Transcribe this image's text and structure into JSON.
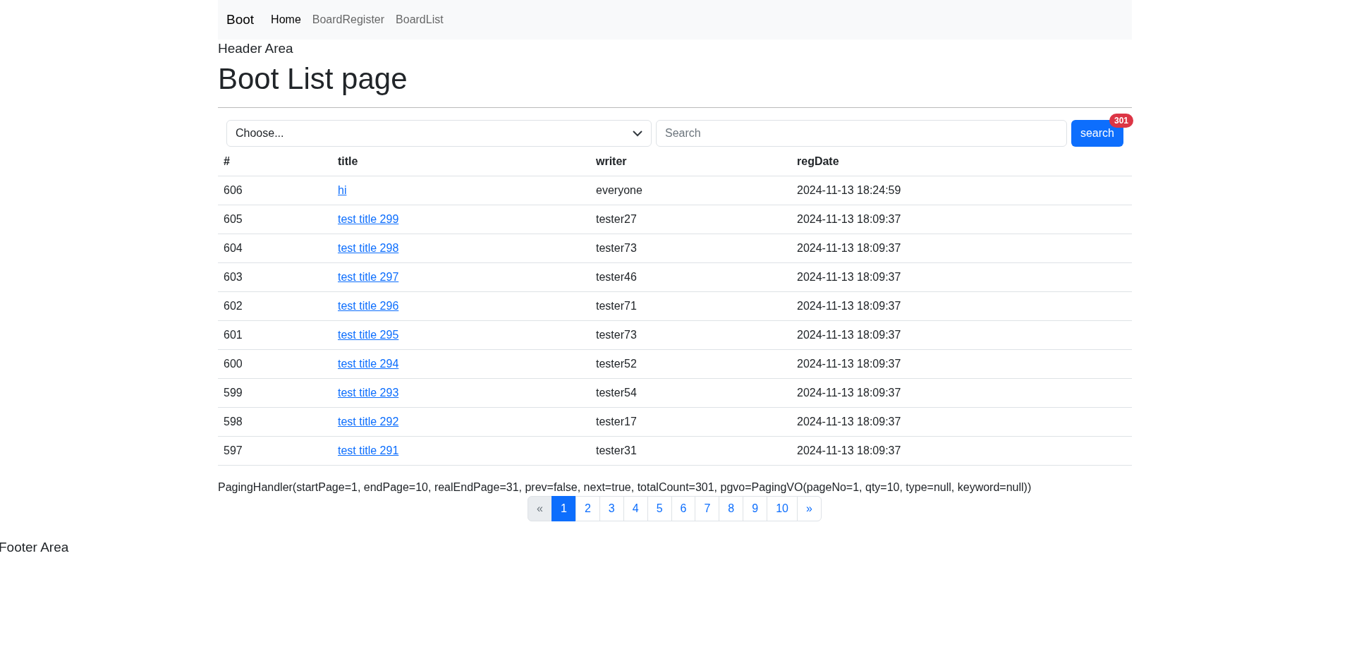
{
  "navbar": {
    "brand": "Boot",
    "items": [
      {
        "label": "Home",
        "selected": true
      },
      {
        "label": "BoardRegister",
        "selected": false
      },
      {
        "label": "BoardList",
        "selected": false
      }
    ]
  },
  "header_text": "Header Area",
  "page_title": "Boot List page",
  "search": {
    "select": "Choose...",
    "placeholder": "Search",
    "button": "search",
    "badge": "301"
  },
  "table": {
    "columns": [
      "#",
      "title",
      "writer",
      "regDate"
    ],
    "rows": [
      {
        "no": "606",
        "title": "hi",
        "writer": "everyone",
        "regDate": "2024-11-13 18:24:59"
      },
      {
        "no": "605",
        "title": "test title 299",
        "writer": "tester27",
        "regDate": "2024-11-13 18:09:37"
      },
      {
        "no": "604",
        "title": "test title 298",
        "writer": "tester73",
        "regDate": "2024-11-13 18:09:37"
      },
      {
        "no": "603",
        "title": "test title 297",
        "writer": "tester46",
        "regDate": "2024-11-13 18:09:37"
      },
      {
        "no": "602",
        "title": "test title 296",
        "writer": "tester71",
        "regDate": "2024-11-13 18:09:37"
      },
      {
        "no": "601",
        "title": "test title 295",
        "writer": "tester73",
        "regDate": "2024-11-13 18:09:37"
      },
      {
        "no": "600",
        "title": "test title 294",
        "writer": "tester52",
        "regDate": "2024-11-13 18:09:37"
      },
      {
        "no": "599",
        "title": "test title 293",
        "writer": "tester54",
        "regDate": "2024-11-13 18:09:37"
      },
      {
        "no": "598",
        "title": "test title 292",
        "writer": "tester17",
        "regDate": "2024-11-13 18:09:37"
      },
      {
        "no": "597",
        "title": "test title 291",
        "writer": "tester31",
        "regDate": "2024-11-13 18:09:37"
      }
    ]
  },
  "paging_info": "PagingHandler(startPage=1, endPage=10, realEndPage=31, prev=false, next=true, totalCount=301, pgvo=PagingVO(pageNo=1, qty=10, type=null, keyword=null))",
  "pagination": [
    {
      "label": "«",
      "disabled": true,
      "selected": false
    },
    {
      "label": "1",
      "disabled": false,
      "selected": true
    },
    {
      "label": "2",
      "disabled": false,
      "selected": false
    },
    {
      "label": "3",
      "disabled": false,
      "selected": false
    },
    {
      "label": "4",
      "disabled": false,
      "selected": false
    },
    {
      "label": "5",
      "disabled": false,
      "selected": false
    },
    {
      "label": "6",
      "disabled": false,
      "selected": false
    },
    {
      "label": "7",
      "disabled": false,
      "selected": false
    },
    {
      "label": "8",
      "disabled": false,
      "selected": false
    },
    {
      "label": "9",
      "disabled": false,
      "selected": false
    },
    {
      "label": "10",
      "disabled": false,
      "selected": false
    },
    {
      "label": "»",
      "disabled": false,
      "selected": false
    }
  ],
  "footer_text": "Footer Area"
}
